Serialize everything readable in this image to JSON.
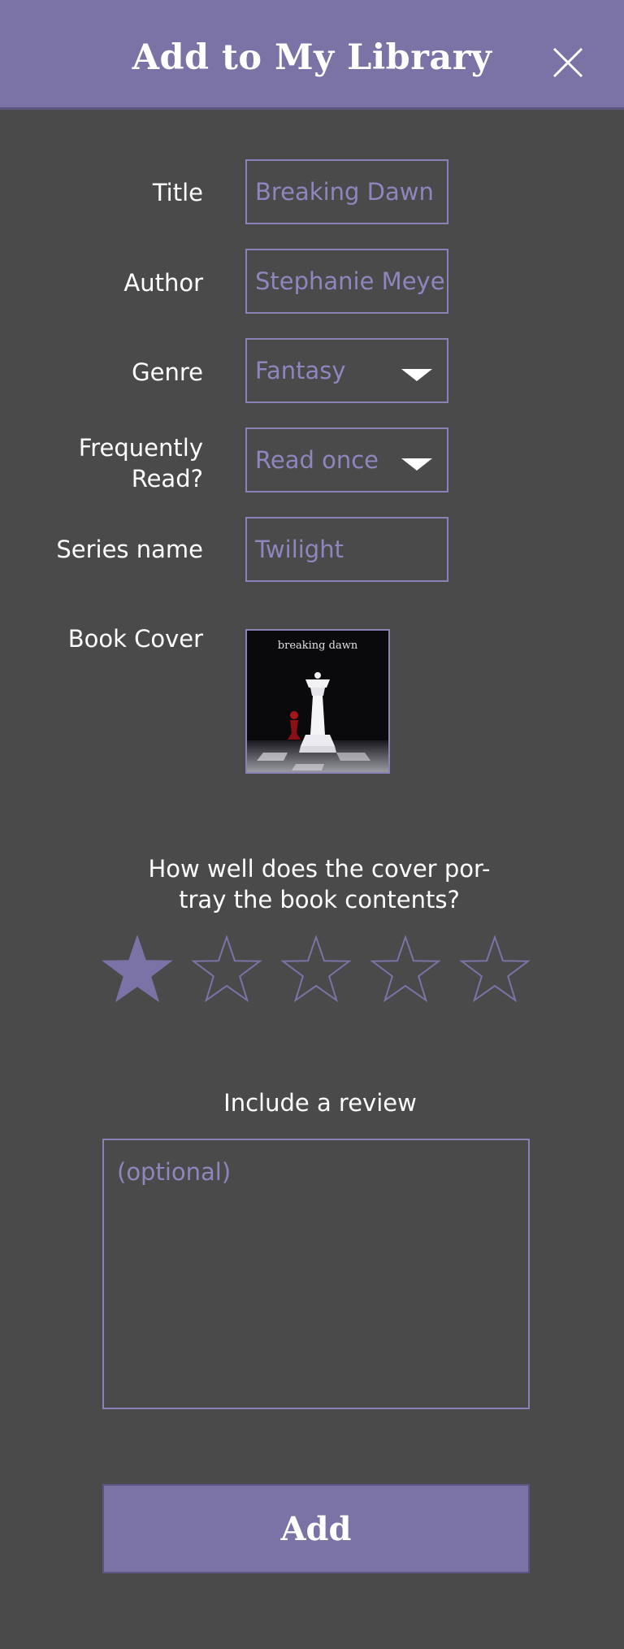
{
  "header": {
    "title": "Add to My Library",
    "close_icon": "close-icon"
  },
  "form": {
    "title": {
      "label": "Title",
      "value": "Breaking Dawn"
    },
    "author": {
      "label": "Author",
      "value": "Stephanie Meyer"
    },
    "genre": {
      "label": "Genre",
      "value": "Fantasy"
    },
    "frequency": {
      "label_line1": "Frequently",
      "label_line2": "Read?",
      "value": "Read once"
    },
    "series": {
      "label": "Series name",
      "value": "Twilight"
    },
    "cover": {
      "label": "Book Cover",
      "cover_text": "breaking dawn"
    }
  },
  "rating": {
    "question_line1": "How well does the cover por-",
    "question_line2": "tray the book contents?",
    "value": 1,
    "max": 5
  },
  "review": {
    "label": "Include a review",
    "placeholder": "(optional)"
  },
  "actions": {
    "add_label": "Add"
  },
  "colors": {
    "accent": "#7b73a6",
    "background": "#4a4a4a",
    "field_text": "#8e86bd"
  }
}
